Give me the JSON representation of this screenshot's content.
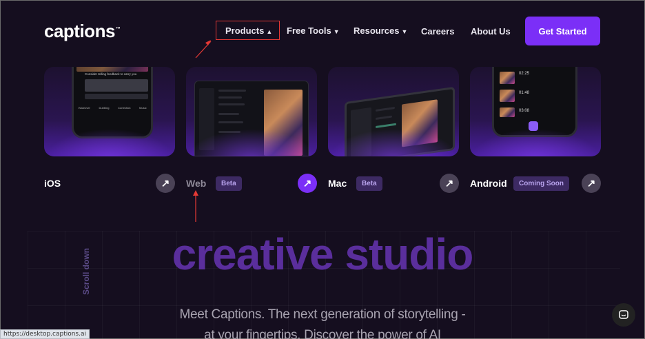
{
  "header": {
    "logo": "captions",
    "logo_mark": "™",
    "nav": [
      {
        "label": "Products",
        "chevron": "▲"
      },
      {
        "label": "Free Tools",
        "chevron": "▼"
      },
      {
        "label": "Resources",
        "chevron": "▼"
      },
      {
        "label": "Careers"
      },
      {
        "label": "About Us"
      }
    ],
    "cta": "Get Started"
  },
  "products": [
    {
      "label": "iOS",
      "icon": "arrow-up-right-icon"
    },
    {
      "label": "Web",
      "badge": "Beta",
      "icon": "arrow-up-right-icon"
    },
    {
      "label": "Mac",
      "badge": "Beta",
      "icon": "arrow-up-right-icon"
    },
    {
      "label": "Android",
      "badge": "Coming Soon",
      "icon": "arrow-up-right-icon"
    }
  ],
  "mock_ui": {
    "ios_caption": "Consider telling feedback to carry you",
    "ios_tools": [
      "Voiceover",
      "Dubbing",
      "Correction",
      "Music"
    ],
    "android_times": [
      "02:25",
      "01:48",
      "03:08"
    ]
  },
  "hero": {
    "title": "creative studio",
    "scroll_label": "Scroll down",
    "subtitle_line1": "Meet Captions. The next generation of storytelling -",
    "subtitle_line2": "at your fingertips. Discover the power of AI"
  },
  "status_bar_url": "https://desktop.captions.ai",
  "colors": {
    "accent": "#7b2ff7",
    "annotation": "#e53935",
    "background": "#150e1f"
  }
}
